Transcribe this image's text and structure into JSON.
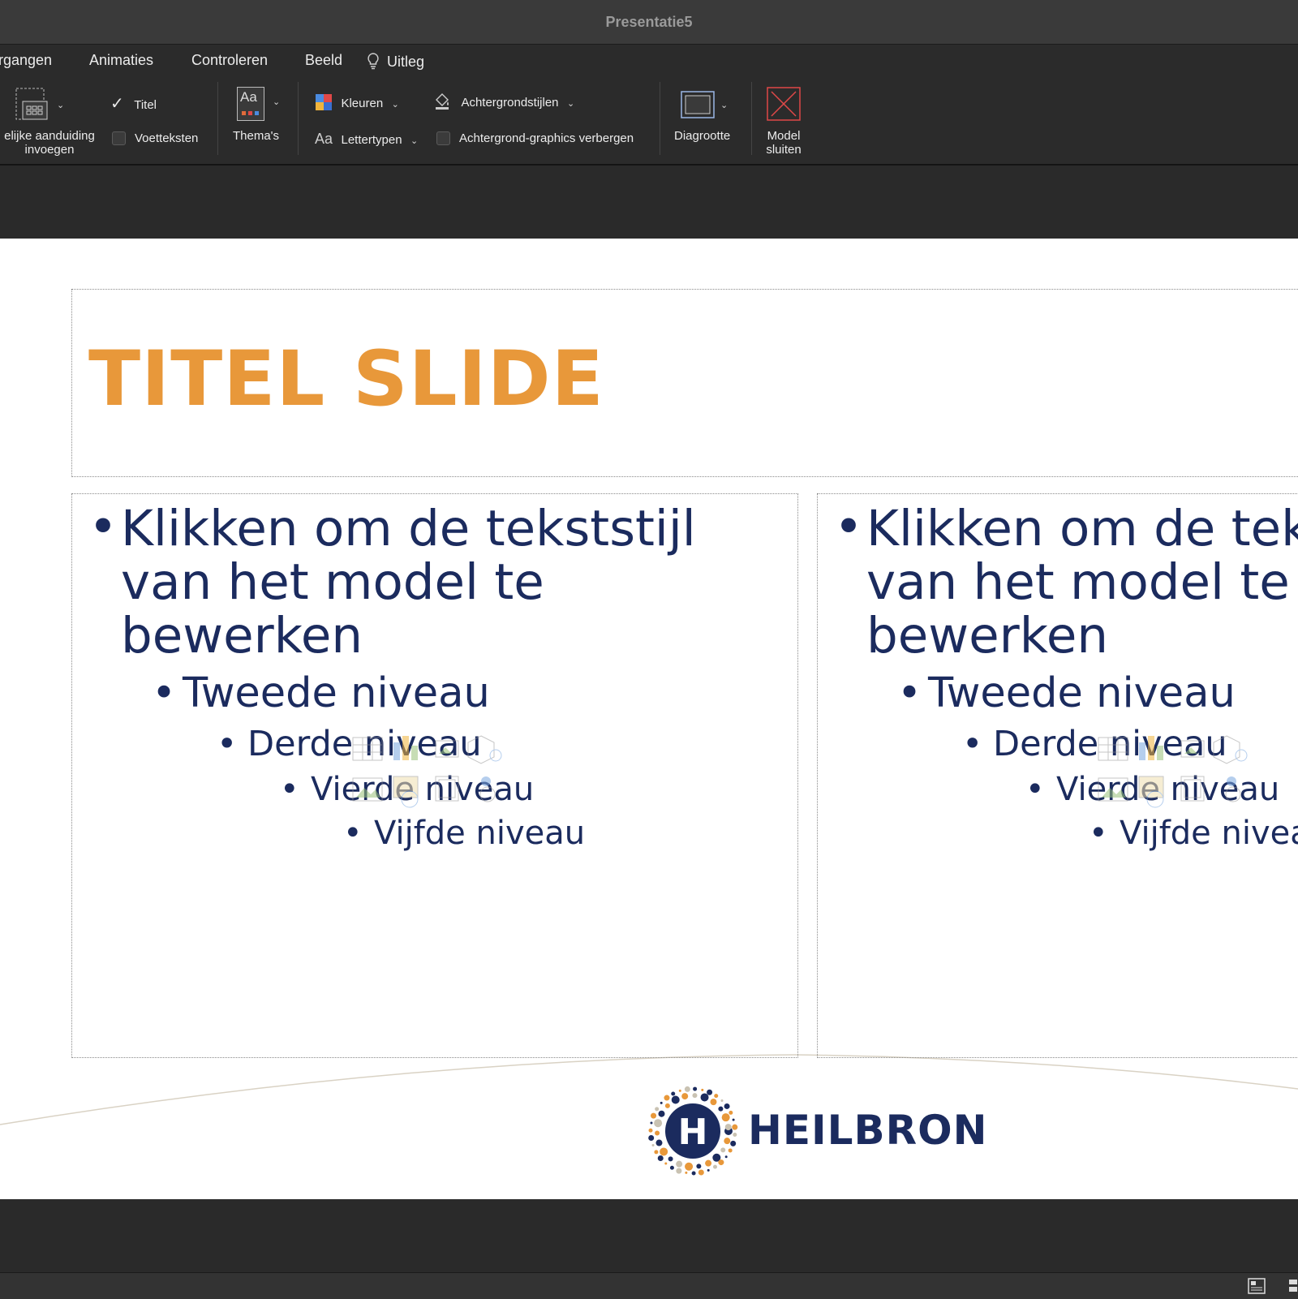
{
  "window": {
    "title": "Presentatie5"
  },
  "menu": {
    "items": [
      "rgangen",
      "Animaties",
      "Controleren",
      "Beeld"
    ],
    "help_label": "Uitleg"
  },
  "ribbon": {
    "placeholder_line1": "elijke aanduiding",
    "placeholder_line2": "invoegen",
    "title_checkbox": "Titel",
    "footer_checkbox": "Voetteksten",
    "themes": "Thema's",
    "themes_icon_text": "Aa",
    "colors": "Kleuren",
    "fonts_prefix": "Aa",
    "fonts": "Lettertypen",
    "background_styles": "Achtergrondstijlen",
    "hide_background_graphics": "Achtergrond-graphics verbergen",
    "slide_size": "Diagrootte",
    "close_line1": "Model",
    "close_line2": "sluiten",
    "title_checked": true,
    "footer_checked": false,
    "hide_bg_checked": false
  },
  "slide": {
    "title": "TITEL SLIDE",
    "left": {
      "l1_line1": "Klikken om de tekststijl",
      "l1_line2": "van het model te",
      "l1_line3": "bewerken",
      "l2": "Tweede niveau",
      "l3": "Derde niveau",
      "l4": "Vierde niveau",
      "l5": "Vijfde niveau"
    },
    "right": {
      "l1_line1": "Klikken om de tekststijl",
      "l1_line2": "van het model te",
      "l1_line3": "bewerken",
      "l2": "Tweede niveau",
      "l3": "Derde niveau",
      "l4": "Vierde niveau",
      "l5": "Vijfde niveau"
    },
    "bullet": "•",
    "logo_text": "HEILBRON",
    "logo_letter": "H"
  },
  "colors": {
    "title_orange": "#e8983a",
    "body_navy": "#1b2b5e",
    "close_red": "#e04848"
  }
}
